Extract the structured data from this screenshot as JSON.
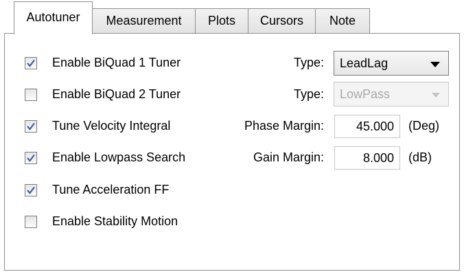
{
  "tabs": [
    {
      "label": "Autotuner",
      "active": true
    },
    {
      "label": "Measurement",
      "active": false
    },
    {
      "label": "Plots",
      "active": false
    },
    {
      "label": "Cursors",
      "active": false
    },
    {
      "label": "Note",
      "active": false
    }
  ],
  "checkboxes": [
    {
      "label": "Enable BiQuad 1 Tuner",
      "checked": true
    },
    {
      "label": "Enable BiQuad 2 Tuner",
      "checked": false
    },
    {
      "label": "Tune Velocity Integral",
      "checked": true
    },
    {
      "label": "Enable Lowpass Search",
      "checked": true
    },
    {
      "label": "Tune Acceleration FF",
      "checked": true
    },
    {
      "label": "Enable Stability Motion",
      "checked": false
    }
  ],
  "type1": {
    "label": "Type:",
    "value": "LeadLag",
    "enabled": true
  },
  "type2": {
    "label": "Type:",
    "value": "LowPass",
    "enabled": false
  },
  "phase_margin": {
    "label": "Phase Margin:",
    "value": "45.000",
    "unit": "(Deg)"
  },
  "gain_margin": {
    "label": "Gain Margin:",
    "value": "8.000",
    "unit": "(dB)"
  },
  "colors": {
    "check": "#3a5fa8",
    "border": "#8f8f8f",
    "disabled_text": "#a9a9a9"
  }
}
